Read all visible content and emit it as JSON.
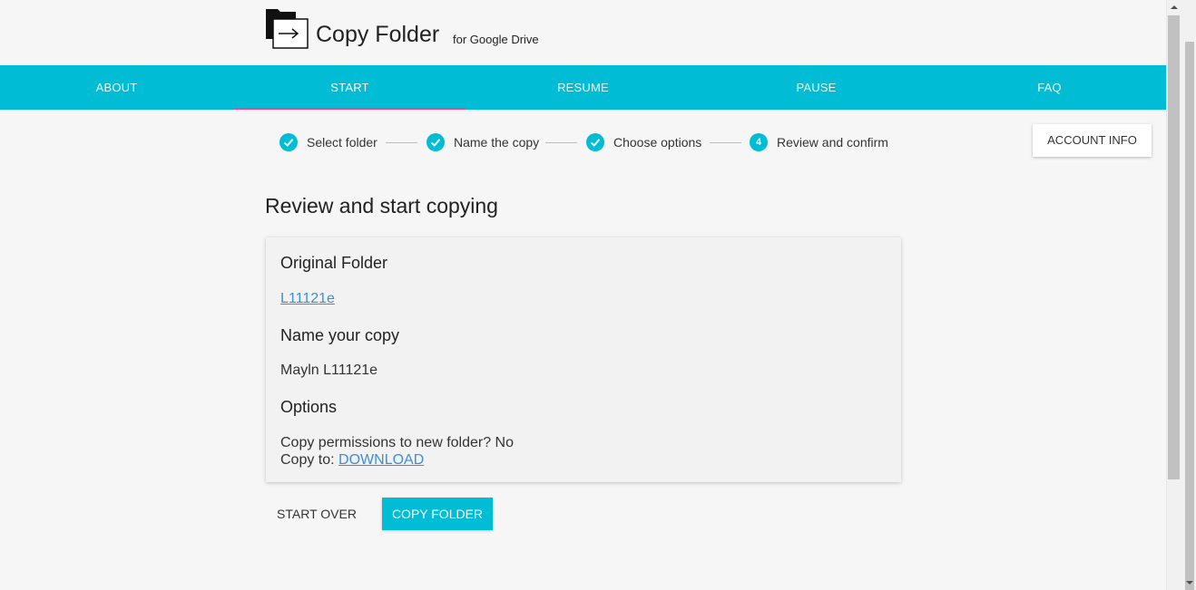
{
  "header": {
    "title": "Copy Folder",
    "subtitle": "for Google Drive"
  },
  "nav": {
    "tabs": [
      {
        "label": "ABOUT",
        "active": false
      },
      {
        "label": "START",
        "active": true
      },
      {
        "label": "RESUME",
        "active": false
      },
      {
        "label": "PAUSE",
        "active": false
      },
      {
        "label": "FAQ",
        "active": false
      }
    ]
  },
  "stepper": {
    "steps": [
      {
        "label": "Select folder",
        "status": "complete",
        "marker": "check-icon"
      },
      {
        "label": "Name the copy",
        "status": "complete",
        "marker": "check-icon"
      },
      {
        "label": "Choose options",
        "status": "complete",
        "marker": "check-icon"
      },
      {
        "label": "Review and confirm",
        "status": "current",
        "number": "4"
      }
    ]
  },
  "account_button": "ACCOUNT INFO",
  "main": {
    "title": "Review and start copying",
    "original_folder": {
      "heading": "Original Folder",
      "link": "L11121e"
    },
    "name_copy": {
      "heading": "Name your copy",
      "value": "Mayln L11121e"
    },
    "options": {
      "heading": "Options",
      "permissions_text": "Copy permissions to new folder? No",
      "copy_to_label": "Copy to: ",
      "copy_to_link": "DOWNLOAD"
    }
  },
  "actions": {
    "start_over": "START OVER",
    "copy_folder": "COPY FOLDER"
  },
  "colors": {
    "accent": "#00bcd4",
    "indicator": "#ff4081",
    "link": "#3b8fd6"
  }
}
